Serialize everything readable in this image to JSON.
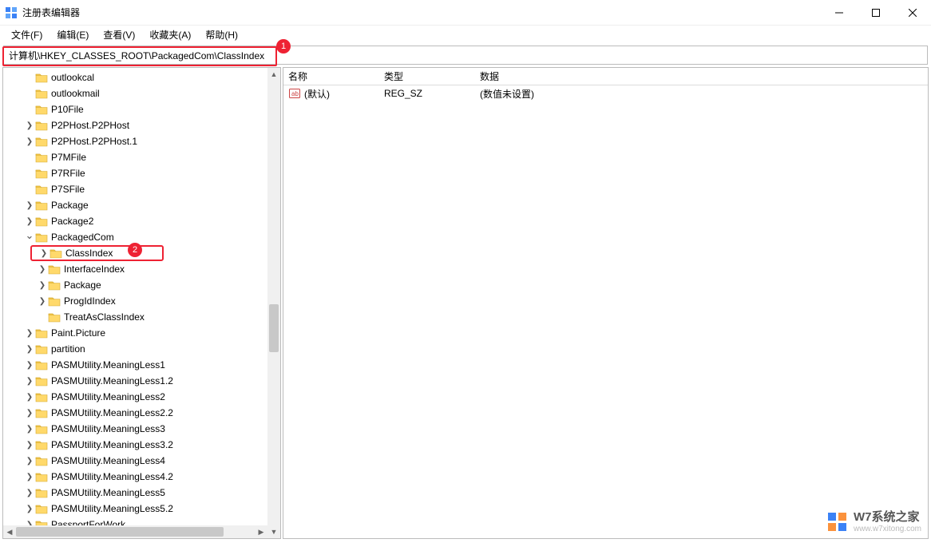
{
  "window": {
    "title": "注册表编辑器"
  },
  "menu": {
    "file": "文件(F)",
    "edit": "编辑(E)",
    "view": "查看(V)",
    "fav": "收藏夹(A)",
    "help": "帮助(H)"
  },
  "address": "计算机\\HKEY_CLASSES_ROOT\\PackagedCom\\ClassIndex",
  "badges": {
    "b1": "1",
    "b2": "2"
  },
  "tree": [
    {
      "level": 1,
      "exp": "",
      "label": "outlookcal"
    },
    {
      "level": 1,
      "exp": "",
      "label": "outlookmail"
    },
    {
      "level": 1,
      "exp": "",
      "label": "P10File"
    },
    {
      "level": 1,
      "exp": ">",
      "label": "P2PHost.P2PHost"
    },
    {
      "level": 1,
      "exp": ">",
      "label": "P2PHost.P2PHost.1"
    },
    {
      "level": 1,
      "exp": "",
      "label": "P7MFile"
    },
    {
      "level": 1,
      "exp": "",
      "label": "P7RFile"
    },
    {
      "level": 1,
      "exp": "",
      "label": "P7SFile"
    },
    {
      "level": 1,
      "exp": ">",
      "label": "Package"
    },
    {
      "level": 1,
      "exp": ">",
      "label": "Package2"
    },
    {
      "level": 1,
      "exp": "v",
      "label": "PackagedCom"
    },
    {
      "level": 2,
      "exp": ">",
      "label": "ClassIndex",
      "selected": true
    },
    {
      "level": 2,
      "exp": ">",
      "label": "InterfaceIndex"
    },
    {
      "level": 2,
      "exp": ">",
      "label": "Package"
    },
    {
      "level": 2,
      "exp": ">",
      "label": "ProgIdIndex"
    },
    {
      "level": 2,
      "exp": "",
      "label": "TreatAsClassIndex"
    },
    {
      "level": 1,
      "exp": ">",
      "label": "Paint.Picture"
    },
    {
      "level": 1,
      "exp": ">",
      "label": "partition"
    },
    {
      "level": 1,
      "exp": ">",
      "label": "PASMUtility.MeaningLess1"
    },
    {
      "level": 1,
      "exp": ">",
      "label": "PASMUtility.MeaningLess1.2"
    },
    {
      "level": 1,
      "exp": ">",
      "label": "PASMUtility.MeaningLess2"
    },
    {
      "level": 1,
      "exp": ">",
      "label": "PASMUtility.MeaningLess2.2"
    },
    {
      "level": 1,
      "exp": ">",
      "label": "PASMUtility.MeaningLess3"
    },
    {
      "level": 1,
      "exp": ">",
      "label": "PASMUtility.MeaningLess3.2"
    },
    {
      "level": 1,
      "exp": ">",
      "label": "PASMUtility.MeaningLess4"
    },
    {
      "level": 1,
      "exp": ">",
      "label": "PASMUtility.MeaningLess4.2"
    },
    {
      "level": 1,
      "exp": ">",
      "label": "PASMUtility.MeaningLess5"
    },
    {
      "level": 1,
      "exp": ">",
      "label": "PASMUtility.MeaningLess5.2"
    },
    {
      "level": 1,
      "exp": ">",
      "label": "PassportForWork"
    }
  ],
  "data": {
    "cols": {
      "name": "名称",
      "type": "类型",
      "data": "数据"
    },
    "rows": [
      {
        "name": "(默认)",
        "type": "REG_SZ",
        "data": "(数值未设置)"
      }
    ]
  },
  "watermark": {
    "l1": "W7系统之家",
    "l2": "www.w7xitong.com"
  }
}
